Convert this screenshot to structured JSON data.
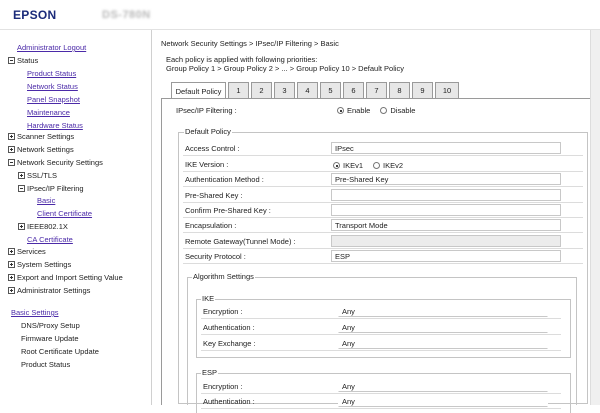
{
  "header": {
    "logo": "EPSON",
    "model": "DS-780N"
  },
  "sidebar": {
    "admin_logout": "Administrator Logout",
    "status": "Status",
    "status_items": [
      "Product Status",
      "Network Status",
      "Panel Snapshot",
      "Maintenance",
      "Hardware Status"
    ],
    "scanner_settings": "Scanner Settings",
    "network_settings": "Network Settings",
    "network_security_settings": "Network Security Settings",
    "ssl_tls": "SSL/TLS",
    "ipsec_filtering": "IPsec/IP Filtering",
    "basic": "Basic",
    "client_certificate": "Client Certificate",
    "ieee8021x": "IEEE802.1X",
    "ca_certificate": "CA Certificate",
    "services": "Services",
    "system_settings": "System Settings",
    "export_import": "Export and Import Setting Value",
    "administrator_settings": "Administrator Settings",
    "basic_settings": "Basic Settings",
    "basic_items": [
      "DNS/Proxy Setup",
      "Firmware Update",
      "Root Certificate Update",
      "Product Status"
    ]
  },
  "main": {
    "breadcrumb": "Network Security Settings > IPsec/IP Filtering > Basic",
    "note_line1": "Each policy is applied with following priorities:",
    "note_line2": "Group Policy 1 > Group Policy 2 > ... > Group Policy 10 > Default Policy",
    "tabs": [
      "Default Policy",
      "1",
      "2",
      "3",
      "4",
      "5",
      "6",
      "7",
      "8",
      "9",
      "10"
    ],
    "filtering_label": "IPsec/IP Filtering :",
    "enable": "Enable",
    "disable": "Disable",
    "default_policy_legend": "Default Policy",
    "access_control_label": "Access Control :",
    "access_control_value": "IPsec",
    "ike_version_label": "IKE Version :",
    "ikev1": "IKEv1",
    "ikev2": "IKEv2",
    "auth_method_label": "Authentication Method :",
    "auth_method_value": "Pre-Shared Key",
    "psk_label": "Pre-Shared Key :",
    "confirm_psk_label": "Confirm Pre-Shared Key :",
    "encapsulation_label": "Encapsulation :",
    "encapsulation_value": "Transport Mode",
    "remote_gateway_label": "Remote Gateway(Tunnel Mode) :",
    "security_protocol_label": "Security Protocol :",
    "security_protocol_value": "ESP",
    "algorithm_legend": "Algorithm Settings",
    "ike_legend": "IKE",
    "ike_encryption_label": "Encryption :",
    "ike_encryption_value": "Any",
    "ike_authentication_label": "Authentication :",
    "ike_authentication_value": "Any",
    "ike_key_exchange_label": "Key Exchange :",
    "ike_key_exchange_value": "Any",
    "esp_legend": "ESP",
    "esp_encryption_label": "Encryption :",
    "esp_encryption_value": "Any",
    "esp_authentication_label": "Authentication :",
    "esp_authentication_value": "Any"
  }
}
